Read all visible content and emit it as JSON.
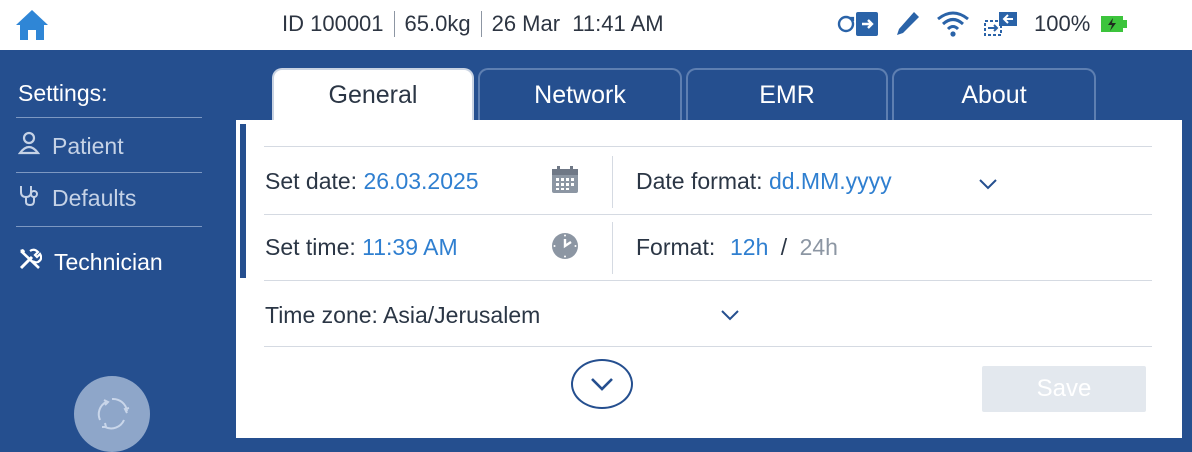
{
  "status_bar": {
    "patient_id": "ID 100001",
    "weight": "65.0kg",
    "datetime": "26 Mar  11:41 AM",
    "battery_percent": "100%",
    "icons": [
      "home-icon",
      "sync-icon",
      "pencil-icon",
      "wifi-icon",
      "network-transfer-icon",
      "battery-charging-icon"
    ]
  },
  "sidebar": {
    "title": "Settings:",
    "items": [
      {
        "label": "Patient",
        "icon": "person-icon"
      },
      {
        "label": "Defaults",
        "icon": "stethoscope-icon"
      },
      {
        "label": "Technician",
        "icon": "tools-icon"
      }
    ]
  },
  "tabs": [
    {
      "label": "General",
      "active": true
    },
    {
      "label": "Network",
      "active": false
    },
    {
      "label": "EMR",
      "active": false
    },
    {
      "label": "About",
      "active": false
    }
  ],
  "general": {
    "set_date_label": "Set date: ",
    "set_date_value": "26.03.2025",
    "date_format_label": "Date format: ",
    "date_format_value": "dd.MM.yyyy",
    "set_time_label": "Set time: ",
    "set_time_value": "11:39 AM",
    "format_label": "Format: ",
    "format_12h": "12h",
    "format_sep": "/",
    "format_24h": "24h",
    "time_zone_label": "Time zone: ",
    "time_zone_value": "Asia/Jerusalem",
    "save_label": "Save"
  },
  "colors": {
    "brand": "#254f8f",
    "accent_value": "#2f7fd0",
    "battery": "#3cc43c",
    "save_disabled": "#e3e8ee"
  }
}
